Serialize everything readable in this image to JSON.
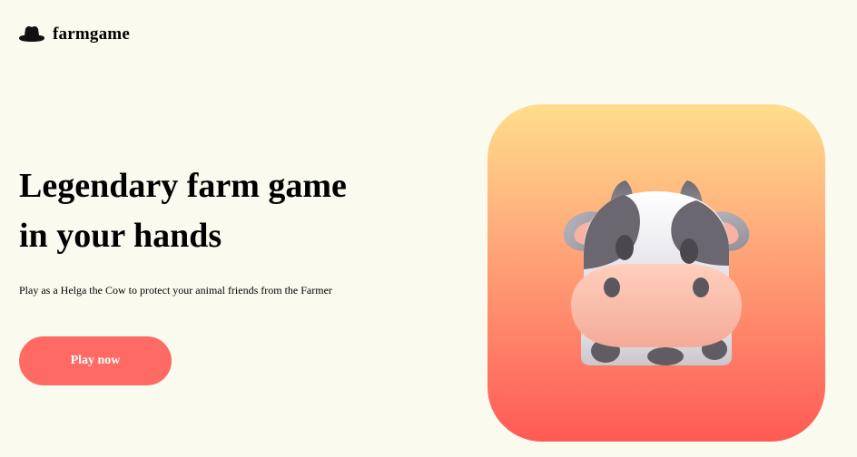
{
  "brand": {
    "name": "farmgame",
    "icon": "cowboy-hat-icon"
  },
  "hero": {
    "title": "Legendary farm game in your hands",
    "description": "Play as a Helga the Cow to protect your animal friends from the Farmer",
    "cta_label": "Play now",
    "illustration": "cow-face-icon"
  },
  "colors": {
    "background": "#fbfaee",
    "accent": "#ff6b64",
    "card_gradient_top": "#ffdd8c",
    "card_gradient_bottom": "#ff5a54"
  }
}
